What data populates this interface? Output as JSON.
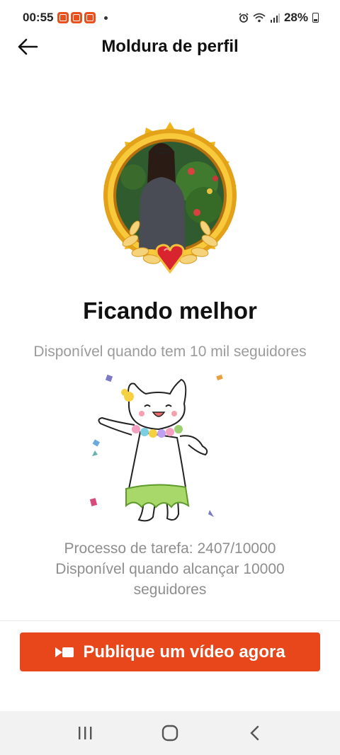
{
  "status": {
    "time": "00:55",
    "battery": "28%"
  },
  "header": {
    "title": "Moldura de perfil"
  },
  "frame": {
    "name": "Ficando melhor",
    "description": "Disponível quando tem 10 mil seguidores"
  },
  "task": {
    "progress_text": "Processo de tarefa: 2407/10000",
    "requirement_text": "Disponível quando alcançar 10000 seguidores"
  },
  "cta": {
    "label": "Publique um vídeo agora"
  },
  "colors": {
    "accent": "#e8461b",
    "gold": "#f2b418"
  }
}
